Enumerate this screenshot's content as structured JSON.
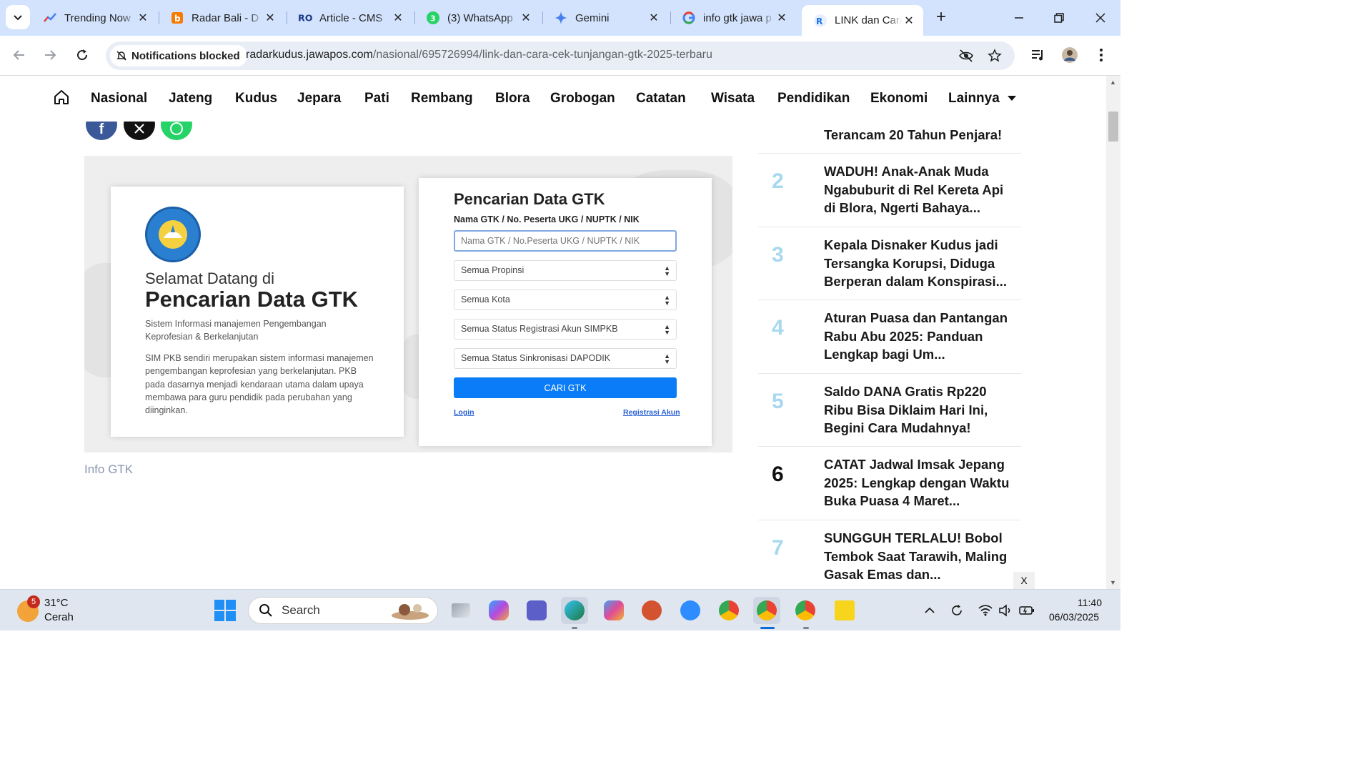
{
  "browser": {
    "tabs": [
      {
        "title": "Trending Now",
        "favicon": "trending-icon",
        "active": false
      },
      {
        "title": "Radar Bali - D",
        "favicon": "radar-bali-icon",
        "active": false
      },
      {
        "title": "Article - CMS",
        "favicon": "cms-icon",
        "active": false
      },
      {
        "title": "(3) WhatsApp",
        "favicon": "whatsapp-icon",
        "active": false,
        "badge": "3"
      },
      {
        "title": "Gemini",
        "favicon": "gemini-icon",
        "active": false
      },
      {
        "title": "info gtk jawa p",
        "favicon": "google-icon",
        "active": false
      },
      {
        "title": "LINK dan Cara",
        "favicon": "radar-kudus-icon",
        "active": true
      }
    ],
    "notifications_chip": "Notifications blocked",
    "url_domain": "radarkudus.jawapos.com",
    "url_path": "/nasional/695726994/link-dan-cara-cek-tunjangan-gtk-2025-terbaru"
  },
  "site_nav": {
    "items": [
      "Nasional",
      "Jateng",
      "Kudus",
      "Jepara",
      "Pati",
      "Rembang",
      "Blora",
      "Grobogan",
      "Catatan",
      "Wisata",
      "Pendidikan",
      "Ekonomi",
      "Lainnya"
    ]
  },
  "article": {
    "image": {
      "welcome_line1": "Selamat Datang di",
      "welcome_line2": "Pencarian Data GTK",
      "system_desc": "Sistem Informasi manajemen Pengembangan Keprofesian & Berkelanjutan",
      "simpkb_desc": "SIM PKB sendiri merupakan sistem informasi manajemen pengembangan keprofesian yang berkelanjutan. PKB pada dasarnya menjadi kendaraan utama dalam upaya membawa para guru pendidik pada perubahan yang diinginkan.",
      "search_title": "Pencarian Data GTK",
      "search_label": "Nama GTK / No. Peserta UKG / NUPTK / NIK",
      "search_placeholder": "Nama GTK / No.Peserta UKG / NUPTK / NIK",
      "selects": [
        "Semua Propinsi",
        "Semua Kota",
        "Semua Status Registrasi Akun SIMPKB",
        "Semua Status Sinkronisasi DAPODIK"
      ],
      "button": "CARI GTK",
      "login": "Login",
      "register": "Registrasi Akun"
    },
    "caption": "Info GTK"
  },
  "popular": [
    {
      "num": "",
      "title": "Terancam 20 Tahun Penjara!"
    },
    {
      "num": "2",
      "title": "WADUH! Anak-Anak Muda Ngabuburit di Rel Kereta Api di Blora, Ngerti Bahaya..."
    },
    {
      "num": "3",
      "title": "Kepala Disnaker Kudus jadi Tersangka Korupsi, Diduga Berperan dalam Konspirasi..."
    },
    {
      "num": "4",
      "title": "Aturan Puasa dan Pantangan Rabu Abu 2025: Panduan Lengkap bagi Um..."
    },
    {
      "num": "5",
      "title": "Saldo DANA Gratis Rp220 Ribu Bisa Diklaim Hari Ini, Begini Cara Mudahnya!"
    },
    {
      "num": "6",
      "title": "CATAT Jadwal Imsak Jepang 2025: Lengkap dengan Waktu Buka Puasa 4 Maret..."
    },
    {
      "num": "7",
      "title": "SUNGGUH TERLALU! Bobol Tembok Saat Tarawih, Maling Gasak Emas dan..."
    }
  ],
  "ad_close": "X",
  "taskbar": {
    "weather_badge": "5",
    "temperature": "31°C",
    "condition": "Cerah",
    "search_label": "Search",
    "time": "11:40",
    "date": "06/03/2025"
  },
  "colors": {
    "tab_strip": "#d3e3fd",
    "accent_blue": "#0a7cf7",
    "popular_number": "#a8d8f0",
    "whatsapp": "#25d366",
    "facebook": "#3b5998"
  }
}
